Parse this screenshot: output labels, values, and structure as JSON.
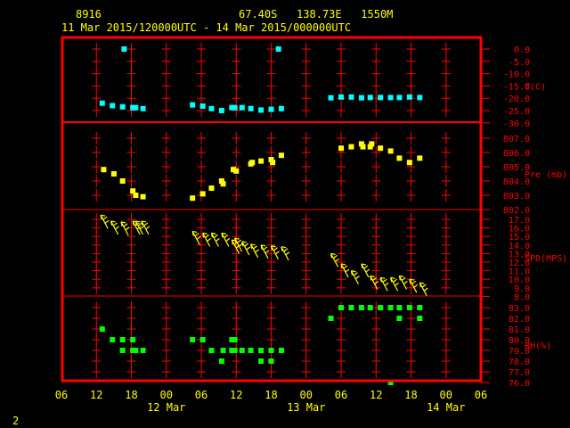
{
  "header": {
    "station": "8916",
    "location": "67.40S   138.73E   1550M",
    "period": "11 Mar 2015/120000UTC - 14 Mar 2015/000000UTC"
  },
  "footer": {
    "page_number": "2"
  },
  "colors": {
    "frame": "#ff0000",
    "text": "#ffff00",
    "temperature": "#00ffff",
    "pressure": "#ffff00",
    "wind": "#ffff00",
    "humidity": "#00ff00"
  },
  "chart_data": [
    {
      "type": "scatter",
      "title": "",
      "ylabel": "T(C)",
      "ylim": [
        -30,
        0
      ],
      "yticks": [
        "0.0",
        "-5.0",
        "-10.0",
        "-15.0",
        "-20.0",
        "-25.0",
        "-30.0"
      ],
      "points": [
        [
          "11 13:00",
          -22.0
        ],
        [
          "11 14:45",
          -23.0
        ],
        [
          "11 16:30",
          -23.5
        ],
        [
          "11 18:15",
          -23.8
        ],
        [
          "11 18:45",
          -23.8
        ],
        [
          "11 20:00",
          -24.2
        ],
        [
          "12 04:30",
          -22.7
        ],
        [
          "12 06:15",
          -23.2
        ],
        [
          "12 07:45",
          -24.2
        ],
        [
          "12 09:30",
          -25.0
        ],
        [
          "12 11:15",
          -23.8
        ],
        [
          "12 11:45",
          -23.8
        ],
        [
          "12 13:00",
          -23.8
        ],
        [
          "12 14:30",
          -24.2
        ],
        [
          "12 16:15",
          -24.8
        ],
        [
          "12 18:00",
          -24.5
        ],
        [
          "12 19:45",
          -24.2
        ],
        [
          "13 04:15",
          -19.8
        ],
        [
          "13 06:00",
          -19.5
        ],
        [
          "13 07:45",
          -19.5
        ],
        [
          "13 09:30",
          -19.8
        ],
        [
          "13 11:00",
          -19.7
        ],
        [
          "13 12:45",
          -19.7
        ],
        [
          "13 14:30",
          -19.7
        ],
        [
          "13 16:00",
          -19.7
        ],
        [
          "13 17:45",
          -19.5
        ],
        [
          "13 19:30",
          -19.7
        ],
        [
          "11 16:45",
          0.0
        ],
        [
          "12 19:15",
          0.0
        ]
      ]
    },
    {
      "type": "scatter",
      "title": "",
      "ylabel": "Pre (mb)",
      "ylim": [
        802,
        807
      ],
      "yticks": [
        "807.0",
        "806.0",
        "805.0",
        "804.0",
        "803.0",
        "802.0"
      ],
      "points": [
        [
          "11 13:15",
          804.8
        ],
        [
          "11 15:00",
          804.5
        ],
        [
          "11 16:30",
          804.0
        ],
        [
          "11 18:15",
          803.3
        ],
        [
          "11 18:45",
          803.0
        ],
        [
          "11 20:00",
          802.9
        ],
        [
          "12 04:30",
          802.8
        ],
        [
          "12 06:15",
          803.1
        ],
        [
          "12 07:45",
          803.5
        ],
        [
          "12 09:30",
          804.0
        ],
        [
          "12 09:45",
          803.8
        ],
        [
          "12 11:30",
          804.8
        ],
        [
          "12 12:00",
          804.7
        ],
        [
          "12 14:30",
          805.2
        ],
        [
          "12 14:45",
          805.3
        ],
        [
          "12 16:15",
          805.4
        ],
        [
          "12 18:00",
          805.5
        ],
        [
          "12 18:15",
          805.3
        ],
        [
          "12 19:45",
          805.8
        ],
        [
          "13 06:00",
          806.3
        ],
        [
          "13 07:45",
          806.4
        ],
        [
          "13 09:30",
          806.6
        ],
        [
          "13 09:45",
          806.4
        ],
        [
          "13 11:00",
          806.4
        ],
        [
          "13 11:15",
          806.6
        ],
        [
          "13 12:45",
          806.3
        ],
        [
          "13 14:30",
          806.1
        ],
        [
          "13 16:00",
          805.6
        ],
        [
          "13 17:45",
          805.3
        ],
        [
          "13 19:30",
          805.6
        ]
      ]
    },
    {
      "type": "scatter",
      "title": "",
      "ylabel": "SPD(MPS)",
      "ylim": [
        8,
        17
      ],
      "yticks": [
        "17.0",
        "16.0",
        "15.0",
        "14.0",
        "13.0",
        "12.0",
        "11.0",
        "10.0",
        "9.0",
        "8.0"
      ],
      "marker": "wind-arrow",
      "direction_to_deg": 330,
      "points": [
        [
          "11 12:45",
          17.5
        ],
        [
          "11 14:30",
          16.8
        ],
        [
          "11 16:15",
          16.7
        ],
        [
          "11 18:15",
          16.8
        ],
        [
          "11 18:45",
          16.8
        ],
        [
          "11 19:45",
          16.8
        ],
        [
          "12 04:30",
          15.6
        ],
        [
          "12 06:15",
          15.4
        ],
        [
          "12 07:45",
          15.4
        ],
        [
          "12 09:30",
          15.4
        ],
        [
          "12 11:15",
          14.6
        ],
        [
          "12 11:45",
          14.8
        ],
        [
          "12 13:00",
          14.4
        ],
        [
          "12 14:30",
          14.1
        ],
        [
          "12 16:15",
          14.0
        ],
        [
          "12 18:00",
          13.9
        ],
        [
          "12 19:45",
          13.8
        ],
        [
          "13 04:15",
          13.0
        ],
        [
          "13 06:00",
          11.8
        ],
        [
          "13 07:45",
          11.0
        ],
        [
          "13 09:30",
          11.8
        ],
        [
          "13 11:00",
          10.4
        ],
        [
          "13 12:45",
          10.2
        ],
        [
          "13 14:30",
          10.2
        ],
        [
          "13 16:00",
          10.4
        ],
        [
          "13 17:45",
          10.0
        ],
        [
          "13 19:30",
          9.6
        ]
      ]
    },
    {
      "type": "scatter",
      "title": "",
      "ylabel": "RH(%)",
      "ylim": [
        76,
        83
      ],
      "yticks": [
        "83.0",
        "82.0",
        "81.0",
        "80.0",
        "79.0",
        "78.0",
        "77.0",
        "76.0"
      ],
      "points": [
        [
          "11 13:00",
          81
        ],
        [
          "11 14:45",
          80
        ],
        [
          "11 16:30",
          80
        ],
        [
          "11 16:30",
          79
        ],
        [
          "11 18:15",
          80
        ],
        [
          "11 18:15",
          79
        ],
        [
          "11 18:45",
          79
        ],
        [
          "11 20:00",
          79
        ],
        [
          "12 04:30",
          80
        ],
        [
          "12 06:15",
          80
        ],
        [
          "12 07:45",
          79
        ],
        [
          "12 09:30",
          78
        ],
        [
          "12 09:45",
          79
        ],
        [
          "12 11:15",
          80
        ],
        [
          "12 11:45",
          80
        ],
        [
          "12 11:15",
          79
        ],
        [
          "12 11:45",
          79
        ],
        [
          "12 13:00",
          79
        ],
        [
          "12 14:30",
          79
        ],
        [
          "12 16:15",
          78
        ],
        [
          "12 16:15",
          79
        ],
        [
          "12 18:00",
          78
        ],
        [
          "12 18:00",
          79
        ],
        [
          "12 19:45",
          79
        ],
        [
          "13 04:15",
          82
        ],
        [
          "13 06:00",
          83
        ],
        [
          "13 07:45",
          83
        ],
        [
          "13 09:30",
          83
        ],
        [
          "13 11:00",
          83
        ],
        [
          "13 12:45",
          83
        ],
        [
          "13 14:30",
          83
        ],
        [
          "13 16:00",
          83
        ],
        [
          "13 16:00",
          82
        ],
        [
          "13 17:45",
          83
        ],
        [
          "13 19:30",
          83
        ],
        [
          "13 19:30",
          82
        ],
        [
          "13 14:30",
          76
        ]
      ]
    }
  ],
  "xaxis": {
    "range": [
      "11 Mar 06Z",
      "14 Mar 06Z"
    ],
    "ticks": [
      "06",
      "12",
      "18",
      "00",
      "06",
      "12",
      "18",
      "00",
      "06",
      "12",
      "18",
      "00",
      "06"
    ],
    "dates": [
      "12 Mar",
      "13 Mar",
      "14 Mar"
    ]
  }
}
